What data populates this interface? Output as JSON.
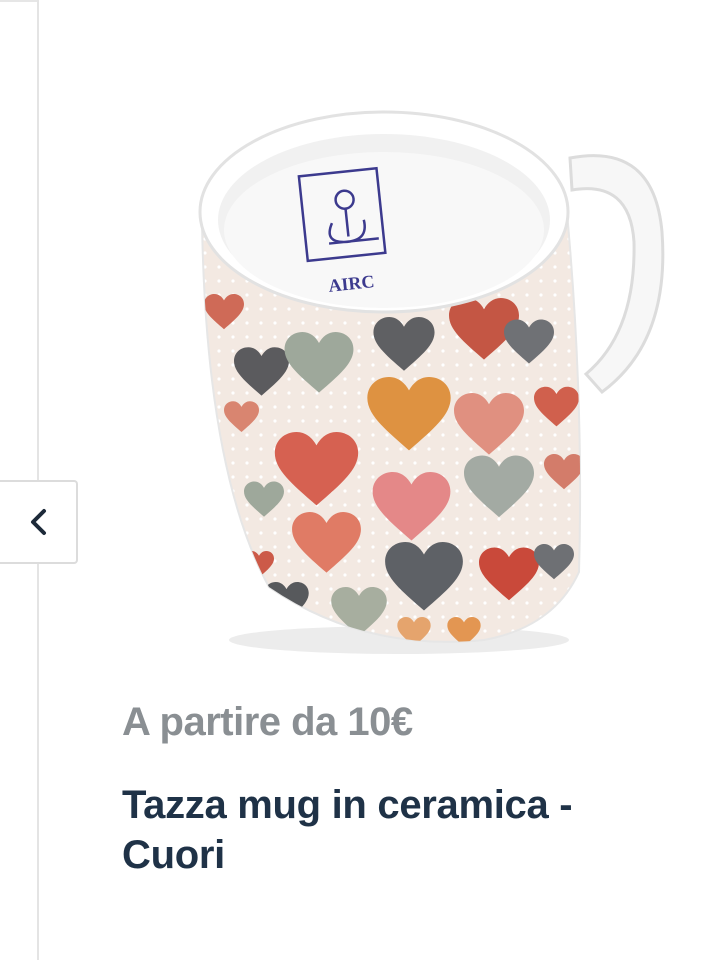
{
  "product": {
    "price_label": "A partire da 10€",
    "title": "Tazza mug in ceramica - Cuori",
    "image": {
      "alt": "Tazza mug in ceramica - Cuori",
      "logo_text": "AIRC"
    }
  },
  "carousel": {
    "prev_icon": "chevron-left-icon",
    "prev_aria": "Previous"
  },
  "colors": {
    "title": "#1f3247",
    "price": "#8a8f93",
    "logo": "#3c3a8e"
  }
}
